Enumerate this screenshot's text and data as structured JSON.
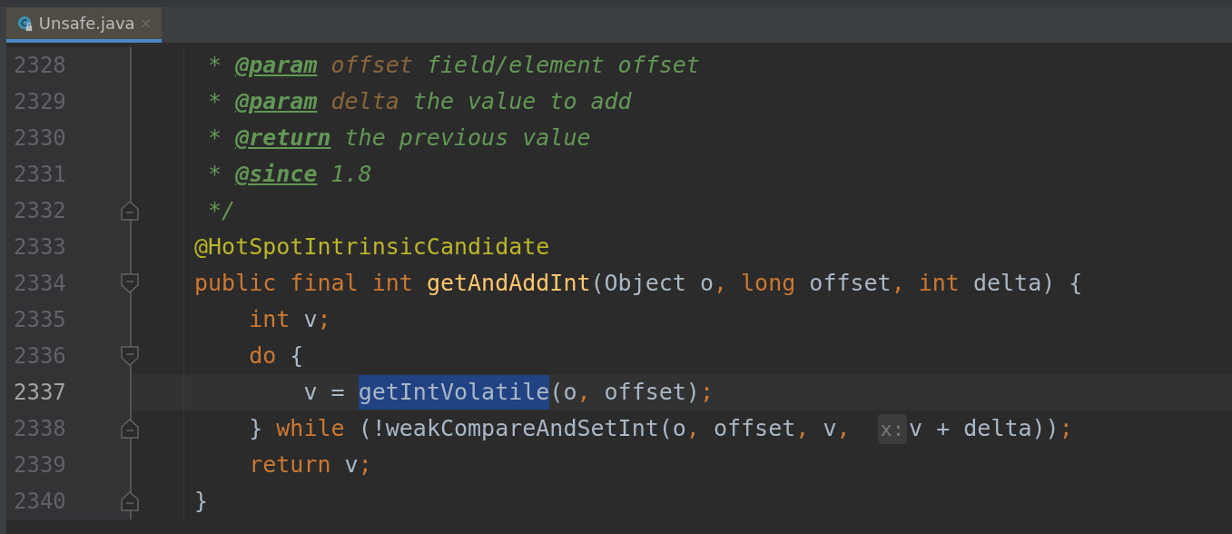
{
  "tabs": [
    {
      "label": "Unsafe.java",
      "selected": true
    }
  ],
  "lines": [
    {
      "number": "2328",
      "current": false,
      "fold_start": false,
      "fold_end": false,
      "tokens": [
        {
          "kind": "comment",
          "text": " * "
        },
        {
          "kind": "doctag",
          "text": "@param"
        },
        {
          "kind": "docparam",
          "text": " offset"
        },
        {
          "kind": "comment",
          "text": " field/element offset"
        }
      ]
    },
    {
      "number": "2329",
      "current": false,
      "fold_start": false,
      "fold_end": false,
      "tokens": [
        {
          "kind": "comment",
          "text": " * "
        },
        {
          "kind": "doctag",
          "text": "@param"
        },
        {
          "kind": "docparam",
          "text": " delta"
        },
        {
          "kind": "comment",
          "text": " the value to add"
        }
      ]
    },
    {
      "number": "2330",
      "current": false,
      "fold_start": false,
      "fold_end": false,
      "tokens": [
        {
          "kind": "comment",
          "text": " * "
        },
        {
          "kind": "doctag",
          "text": "@return"
        },
        {
          "kind": "comment",
          "text": " the previous value"
        }
      ]
    },
    {
      "number": "2331",
      "current": false,
      "fold_start": false,
      "fold_end": false,
      "tokens": [
        {
          "kind": "comment",
          "text": " * "
        },
        {
          "kind": "doctag",
          "text": "@since"
        },
        {
          "kind": "comment",
          "text": " 1.8"
        }
      ]
    },
    {
      "number": "2332",
      "current": false,
      "fold_start": false,
      "fold_end": true,
      "tokens": [
        {
          "kind": "comment",
          "text": " */"
        }
      ]
    },
    {
      "number": "2333",
      "current": false,
      "fold_start": false,
      "fold_end": false,
      "tokens": [
        {
          "kind": "annotation",
          "text": "@HotSpotIntrinsicCandidate"
        }
      ]
    },
    {
      "number": "2334",
      "current": false,
      "fold_start": true,
      "fold_end": false,
      "tokens": [
        {
          "kind": "keyword",
          "text": "public final int "
        },
        {
          "kind": "method",
          "text": "getAndAddInt"
        },
        {
          "kind": "plain",
          "text": "(Object o"
        },
        {
          "kind": "keyword",
          "text": ", long "
        },
        {
          "kind": "plain",
          "text": "offset"
        },
        {
          "kind": "keyword",
          "text": ", int "
        },
        {
          "kind": "plain",
          "text": "delta) {"
        }
      ]
    },
    {
      "number": "2335",
      "current": false,
      "fold_start": false,
      "fold_end": false,
      "tokens": [
        {
          "kind": "keyword",
          "text": "    int "
        },
        {
          "kind": "plain",
          "text": "v"
        },
        {
          "kind": "keyword",
          "text": ";"
        }
      ]
    },
    {
      "number": "2336",
      "current": false,
      "fold_start": true,
      "fold_end": false,
      "tokens": [
        {
          "kind": "keyword",
          "text": "    do "
        },
        {
          "kind": "plain",
          "text": "{"
        }
      ]
    },
    {
      "number": "2337",
      "current": true,
      "fold_start": false,
      "fold_end": false,
      "tokens": [
        {
          "kind": "plain",
          "text": "        v = "
        },
        {
          "kind": "selected",
          "text": "getIntVolatile"
        },
        {
          "kind": "plain",
          "text": "(o"
        },
        {
          "kind": "keyword",
          "text": ", "
        },
        {
          "kind": "plain",
          "text": "offset)"
        },
        {
          "kind": "keyword",
          "text": ";"
        }
      ]
    },
    {
      "number": "2338",
      "current": false,
      "fold_start": false,
      "fold_end": true,
      "tokens": [
        {
          "kind": "plain",
          "text": "    } "
        },
        {
          "kind": "keyword",
          "text": "while "
        },
        {
          "kind": "plain",
          "text": "(!weakCompareAndSetInt(o"
        },
        {
          "kind": "keyword",
          "text": ", "
        },
        {
          "kind": "plain",
          "text": "offset"
        },
        {
          "kind": "keyword",
          "text": ", "
        },
        {
          "kind": "plain",
          "text": "v"
        },
        {
          "kind": "keyword",
          "text": ",  "
        },
        {
          "kind": "hint",
          "text": "x:"
        },
        {
          "kind": "plain",
          "text": "v + delta))"
        },
        {
          "kind": "keyword",
          "text": ";"
        }
      ]
    },
    {
      "number": "2339",
      "current": false,
      "fold_start": false,
      "fold_end": false,
      "tokens": [
        {
          "kind": "keyword",
          "text": "    return "
        },
        {
          "kind": "plain",
          "text": "v"
        },
        {
          "kind": "keyword",
          "text": ";"
        }
      ]
    },
    {
      "number": "2340",
      "current": false,
      "fold_start": false,
      "fold_end": true,
      "tokens": [
        {
          "kind": "plain",
          "text": "}"
        }
      ]
    }
  ]
}
